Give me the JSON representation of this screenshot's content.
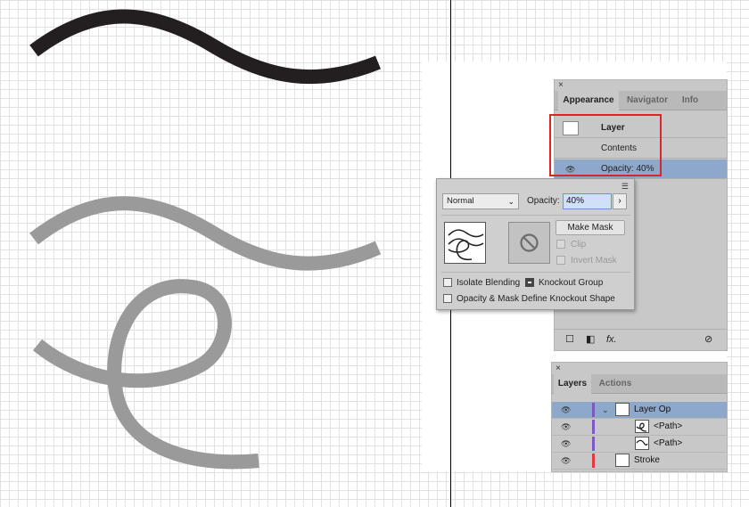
{
  "appearance": {
    "tabs": [
      "Appearance",
      "Navigator",
      "Info"
    ],
    "rows": {
      "layer": "Layer",
      "contents": "Contents",
      "opacity": "Opacity: 40%"
    }
  },
  "transparency": {
    "blend_mode": "Normal",
    "opacity_label": "Opacity:",
    "opacity_value": "40%",
    "make_mask": "Make Mask",
    "clip": "Clip",
    "invert_mask": "Invert Mask",
    "isolate_blending": "Isolate Blending",
    "knockout_group": "Knockout Group",
    "opacity_mask_knockout": "Opacity & Mask Define Knockout Shape"
  },
  "layers": {
    "tabs": [
      "Layers",
      "Actions"
    ],
    "rows": [
      "Layer Op",
      "<Path>",
      "<Path>",
      "Stroke"
    ]
  },
  "colors": {
    "selection": "#8ea8cc",
    "highlight_box": "#e0232a",
    "stroke_black": "#231f20",
    "stroke_gray": "#999999",
    "layer_color_purple": "#7e57c2",
    "layer_color_red": "#e53935"
  },
  "icons": {
    "eye": "eye-icon",
    "expand": "chevron-down-icon",
    "panel_menu": "menu-icon",
    "fx": "fx-icon",
    "delete": "no-symbol-icon"
  }
}
